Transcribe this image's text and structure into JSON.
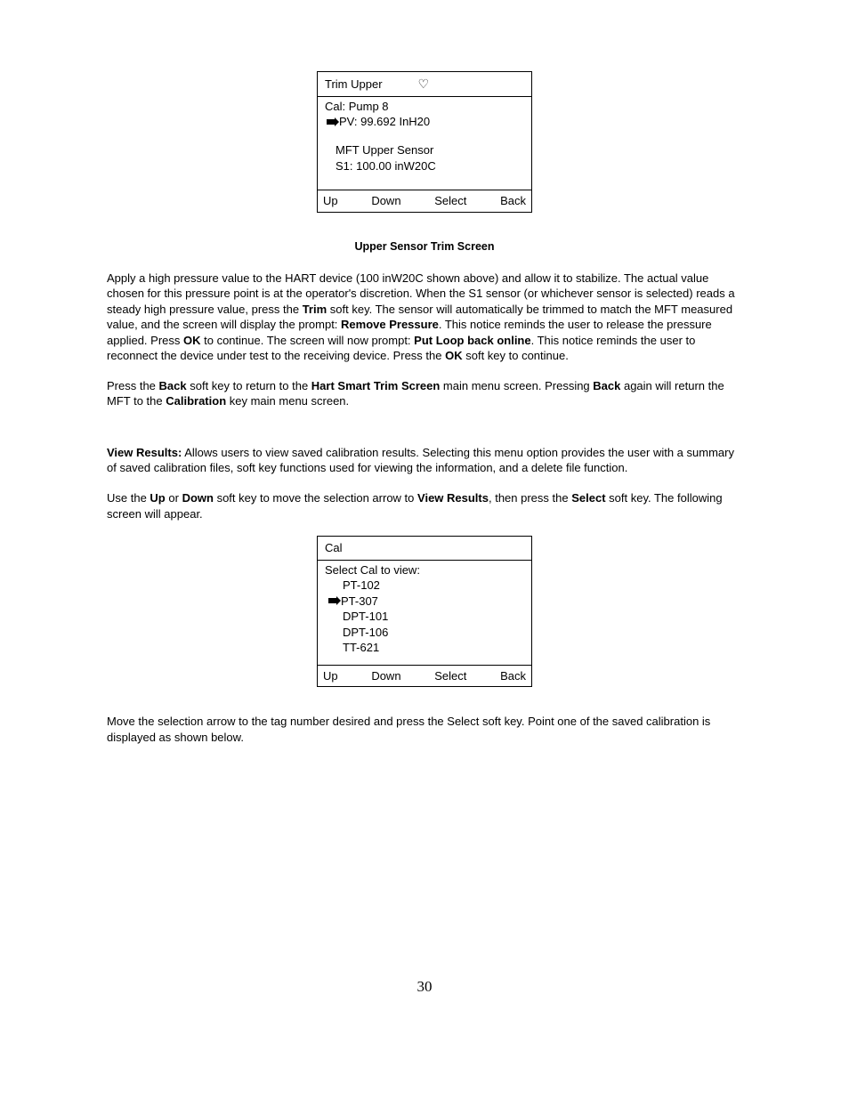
{
  "screen1": {
    "title": "Trim Upper",
    "heart": "♡",
    "line1": "Cal: Pump 8",
    "pv": "PV: 99.692 InH20",
    "mft": "MFT Upper Sensor",
    "s1": "S1:  100.00 inW20C",
    "keys": {
      "up": "Up",
      "down": "Down",
      "select": "Select",
      "back": "Back"
    }
  },
  "caption1": "Upper Sensor Trim Screen",
  "para1": {
    "t1": "Apply a high pressure value to the HART device (100 inW20C shown above) and allow it to stabilize. The actual value chosen for this pressure point is at the operator's discretion. When the S1 sensor (or whichever sensor is selected) reads a steady high pressure value, press the ",
    "b1": "Trim",
    "t2": " soft key. The sensor will automatically be trimmed to match the MFT measured value, and the screen will display the prompt: ",
    "b2": "Remove Pressure",
    "t3": ". This notice reminds the user to release the pressure applied. Press ",
    "b3": "OK",
    "t4": " to continue. The screen will now prompt: ",
    "b4": "Put Loop back online",
    "t5": ".  This notice reminds the user to reconnect the device under test to the receiving device.  Press the ",
    "b5": "OK",
    "t6": " soft key to continue."
  },
  "para2": {
    "t1": "Press the ",
    "b1": "Back",
    "t2": " soft key to return to the ",
    "b2": "Hart Smart Trim Screen",
    "t3": " main menu screen. Pressing ",
    "b3": "Back",
    "t4": " again will return the MFT to the ",
    "b4": "Calibration",
    "t5": " key main menu screen."
  },
  "para3": {
    "b1": "View Results:",
    "t1": " Allows users to view saved calibration results.  Selecting this menu option provides the user with a summary of saved calibration files, soft key functions used for viewing the information, and a delete file function."
  },
  "para4": {
    "t1": "Use the ",
    "b1": "Up",
    "t2": " or ",
    "b2": "Down",
    "t3": " soft key to move the selection arrow to ",
    "b3": "View Results",
    "t4": ", then press the ",
    "b4": "Select",
    "t5": " soft key. The following screen will appear."
  },
  "screen2": {
    "title": "Cal",
    "line1": "Select Cal to view:",
    "items": [
      "PT-102",
      "PT-307",
      "DPT-101",
      "DPT-106",
      "TT-621"
    ],
    "selected_index": 1,
    "keys": {
      "up": "Up",
      "down": "Down",
      "select": "Select",
      "back": "Back"
    }
  },
  "para5": "Move the selection arrow to the tag number desired and press the Select soft key.  Point one of the saved calibration is displayed as shown below.",
  "page_number": "30"
}
